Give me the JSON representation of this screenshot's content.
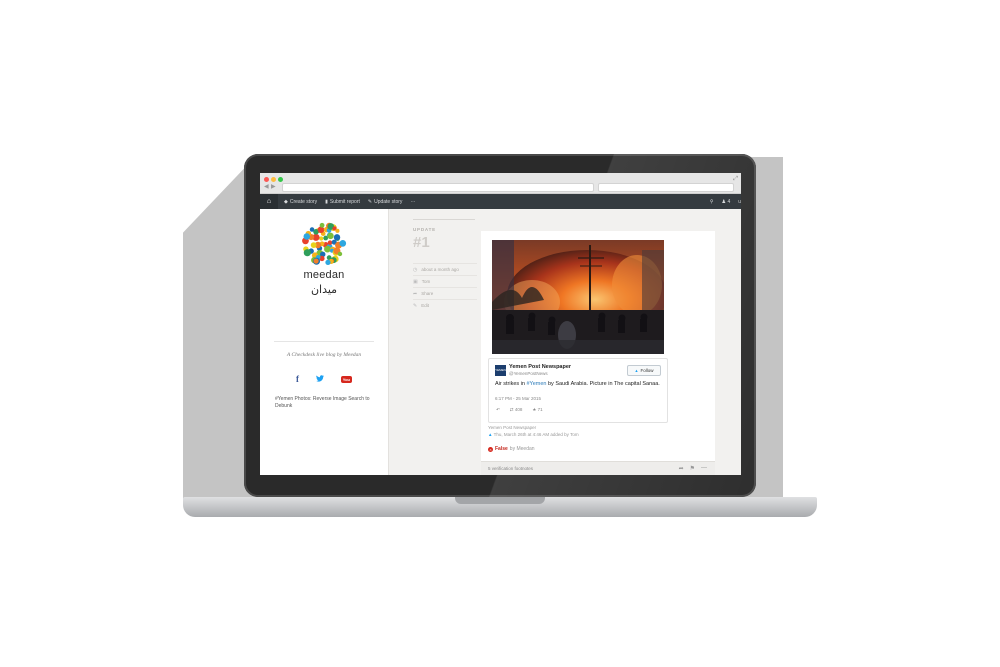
{
  "browser": {
    "back_icon": "back-arrow-icon",
    "forward_icon": "forward-arrow-icon"
  },
  "nav": {
    "create_story": "Create story",
    "submit_report": "Submit report",
    "update_story": "Update story",
    "more": "···",
    "user_count": "4",
    "user_label": "u"
  },
  "sidebar": {
    "brand": "meedan",
    "brand_arabic": "ميدان",
    "tagline": "A Checkdesk live blog by Meedan",
    "facebook": "f",
    "youtube": "You",
    "link": "#Yemen Photos: Reverse Image Search to Debunk"
  },
  "update": {
    "label": "UPDATE",
    "number": "#1",
    "time": "about a month ago",
    "author": "Tom",
    "share": "Share",
    "edit": "Edit"
  },
  "tweet": {
    "account_name": "Yemen Post Newspaper",
    "handle": "@YemenPostNews",
    "follow": "Follow",
    "text_before": "Air strikes in ",
    "hashtag": "#Yemen",
    "text_after": " by Saudi Arabia. Picture in The capital Sanaa.",
    "time": "6:17 PM - 25 Mar 2015",
    "retweets": "408",
    "favorites": "71",
    "avatar_text": "YEMEN POST"
  },
  "source": {
    "name": "Yemen Post Newspaper",
    "date": "Thu, March 26th at 4:46 AM added by Tom"
  },
  "status": {
    "label": "False",
    "by": "by Meedan"
  },
  "footnotes": {
    "label": "5 verification footnotes"
  },
  "colors": {
    "nav_bar": "#353b40",
    "false_red": "#c4271d",
    "twitter_blue": "#1da1f2",
    "page_bg": "#f2f1ef"
  }
}
